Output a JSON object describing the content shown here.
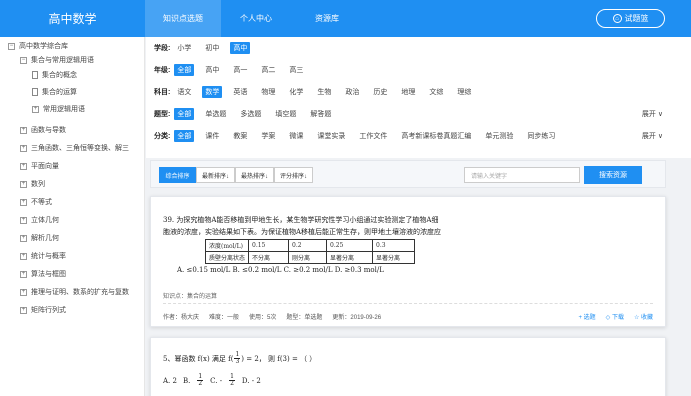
{
  "header": {
    "brand": "高中数学",
    "tabs": [
      {
        "label": "知识点选题",
        "active": true
      },
      {
        "label": "个人中心",
        "active": false
      },
      {
        "label": "资源库",
        "active": false
      }
    ],
    "basket_label": "试题篮",
    "basket_icon": "cart-icon"
  },
  "sidebar": {
    "items": [
      {
        "label": "高中数学综合库",
        "marker": "−"
      },
      {
        "label": "集合与常用逻辑用语",
        "marker": "−"
      },
      {
        "label": "集合的概念",
        "marker": "doc"
      },
      {
        "label": "集合的运算",
        "marker": "doc"
      },
      {
        "label": "常用逻辑用语",
        "marker": "+"
      },
      {
        "label": "函数与导数",
        "marker": "+"
      },
      {
        "label": "三角函数、三角恒等变换、解三",
        "marker": "+"
      },
      {
        "label": "平面向量",
        "marker": "+"
      },
      {
        "label": "数列",
        "marker": "+"
      },
      {
        "label": "不等式",
        "marker": "+"
      },
      {
        "label": "立体几何",
        "marker": "+"
      },
      {
        "label": "解析几何",
        "marker": "+"
      },
      {
        "label": "统计与概率",
        "marker": "+"
      },
      {
        "label": "算法与框图",
        "marker": "+"
      },
      {
        "label": "推理与证明、数系的扩充与复数",
        "marker": "+"
      },
      {
        "label": "矩阵行列式",
        "marker": "+"
      }
    ]
  },
  "filters": {
    "stage": {
      "label": "学段:",
      "options": [
        "小学",
        "初中",
        "高中"
      ],
      "selected": "高中"
    },
    "grade": {
      "label": "年级:",
      "options": [
        "全部",
        "高中",
        "高一",
        "高二",
        "高三"
      ],
      "selected": "全部"
    },
    "subject": {
      "label": "科目:",
      "options": [
        "语文",
        "数学",
        "英语",
        "物理",
        "化学",
        "生物",
        "政治",
        "历史",
        "地理",
        "文综",
        "理综"
      ],
      "selected": "数学"
    },
    "qtype": {
      "label": "题型:",
      "options": [
        "全部",
        "单选题",
        "多选题",
        "填空题",
        "解答题"
      ],
      "selected": "全部"
    },
    "category": {
      "label": "分类:",
      "options": [
        "全部",
        "课件",
        "教案",
        "学案",
        "微课",
        "课堂实录",
        "工作文件",
        "高考新课标卷真题汇编",
        "单元测验",
        "同步练习"
      ],
      "selected": "全部"
    },
    "expand_label": "展开"
  },
  "sortbar": {
    "sorts": [
      "综合排序",
      "最新排序↓",
      "最热排序↓",
      "评分排序↓"
    ],
    "selected": "综合排序",
    "search_placeholder": "请输入关键字",
    "search_button": "搜索资源"
  },
  "questions": [
    {
      "line1": "39. 为探究植物A能否移植到甲地生长，某生物学研究性学习小组通过实验测定了植物A细",
      "line2": "胞液的浓度，实验结果如下表。为保证植物A移植后能正常生存，则甲地土壤溶液的浓度应",
      "table": [
        [
          "浓度(mol/L)",
          "0.15",
          "0.2",
          "0.25",
          "0.3"
        ],
        [
          "质壁分离状态",
          "不分离",
          "刚分离",
          "显著分离",
          "显著分离"
        ]
      ],
      "options": "A. ≤0.15 mol/L   B. ≤0.2 mol/L   C. ≥0.2 mol/L   D. ≥0.3 mol/L",
      "knowledge_point": "知识点：集合的运算",
      "meta": {
        "author": "作者：杨大庆",
        "difficulty": "难度：一般",
        "usage": "使用：5次",
        "type": "题型：单选题",
        "updated": "更新：2019-09-26"
      },
      "actions": [
        "+ 选题",
        "◇ 下载",
        "☆ 收藏"
      ]
    },
    {
      "stem_prefix": "5、幂函数 f(x) 满足 f(",
      "stem_frac_n": "1",
      "stem_frac_d": "3",
      "stem_suffix": ") = 2， 则 f(3) = （        ）",
      "opt_a": "A. 2",
      "opt_b": "B.",
      "opt_b_n": "1",
      "opt_b_d": "2",
      "opt_c": "C. -",
      "opt_c_n": "1",
      "opt_c_d": "2",
      "opt_d": "D. - 2"
    }
  ],
  "colors": {
    "accent": "#1f8ff2"
  }
}
